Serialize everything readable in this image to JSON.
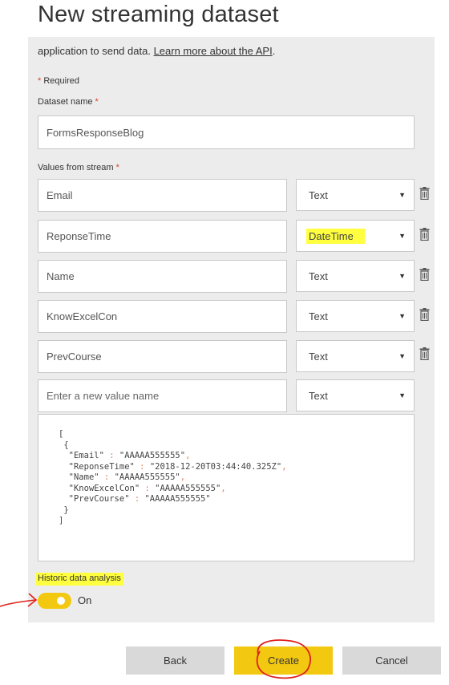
{
  "page": {
    "title": "New streaming dataset",
    "description_text": "application to send data.",
    "learn_more_link": "Learn more about the API",
    "description_tail": ".",
    "required_note": "Required",
    "required_star": "*"
  },
  "dataset_name": {
    "label": "Dataset name",
    "value": "FormsResponseBlog"
  },
  "values_from_stream": {
    "label": "Values from stream",
    "rows": [
      {
        "name": "Email",
        "type": "Text",
        "highlighted": false
      },
      {
        "name": "ReponseTime",
        "type": "DateTime",
        "highlighted": true
      },
      {
        "name": "Name",
        "type": "Text",
        "highlighted": false
      },
      {
        "name": "KnowExcelCon",
        "type": "Text",
        "highlighted": false
      },
      {
        "name": "PrevCourse",
        "type": "Text",
        "highlighted": false
      }
    ],
    "new_row": {
      "placeholder": "Enter a new value name",
      "type": "Text"
    }
  },
  "json_preview": {
    "open_bracket": "[",
    "open_brace": "{",
    "lines": [
      {
        "key": "\"Email\"",
        "value": "\"AAAAA555555\"",
        "sep": ","
      },
      {
        "key": "\"ReponseTime\"",
        "value": "\"2018-12-20T03:44:40.325Z\"",
        "sep": ","
      },
      {
        "key": "\"Name\"",
        "value": "\"AAAAA555555\"",
        "sep": ","
      },
      {
        "key": "\"KnowExcelCon\"",
        "value": "\"AAAAA555555\"",
        "sep": ","
      },
      {
        "key": "\"PrevCourse\"",
        "value": "\"AAAAA555555\"",
        "sep": ""
      }
    ],
    "close_brace": "}",
    "close_bracket": "]"
  },
  "historic": {
    "label": "Historic data analysis",
    "toggle_state": "On"
  },
  "buttons": {
    "back": "Back",
    "create": "Create",
    "cancel": "Cancel"
  },
  "colors": {
    "accent": "#f2c811",
    "highlight": "#ffff3f",
    "annotation": "#e0201b",
    "required": "#d9452b"
  },
  "icons": {
    "delete": "trash-icon",
    "dropdown": "caret-down-icon"
  }
}
